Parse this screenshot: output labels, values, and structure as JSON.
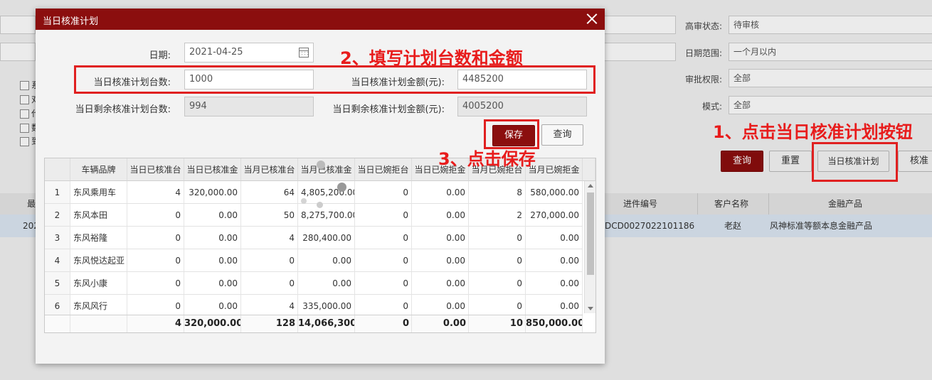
{
  "background": {
    "filters": [
      {
        "label": "高审状态:",
        "value": "待审核"
      },
      {
        "label": "日期范围:",
        "value": "一个月以内"
      },
      {
        "label": "审批权限:",
        "value": "全部"
      },
      {
        "label": "模式:",
        "value": "全部"
      }
    ],
    "checkbox_glyphs": [
      "系",
      "对",
      "代",
      "数",
      "到"
    ],
    "buttons": {
      "query": "查询",
      "reset": "重置",
      "daily_plan": "当日核准计划",
      "approve": "核准"
    },
    "table": {
      "headers": [
        "最",
        "进件编号",
        "客户名称",
        "金融产品"
      ],
      "row": [
        "202",
        "DCD0027022101186",
        "老赵",
        "风神标准等额本息金融产品"
      ]
    }
  },
  "dialog": {
    "title": "当日核准计划",
    "date_label": "日期:",
    "date_value": "2021-04-25",
    "plan_count_label": "当日核准计划台数:",
    "plan_count_value": "1000",
    "plan_amount_label": "当日核准计划金额(元):",
    "plan_amount_value": "4485200",
    "remain_count_label": "当日剩余核准计划台数:",
    "remain_count_value": "994",
    "remain_amount_label": "当日剩余核准计划金额(元):",
    "remain_amount_value": "4005200",
    "save_label": "保存",
    "query_label": "查询",
    "grid": {
      "headers": [
        "",
        "车辆品牌",
        "当日已核准台",
        "当日已核准金",
        "当月已核准台",
        "当月已核准金",
        "当日已婉拒台",
        "当日已婉拒金",
        "当月已婉拒台",
        "当月已婉拒金"
      ],
      "rows": [
        [
          "1",
          "东风乘用车",
          "4",
          "320,000.00",
          "64",
          "4,805,200.00",
          "0",
          "0.00",
          "8",
          "580,000.00"
        ],
        [
          "2",
          "东风本田",
          "0",
          "0.00",
          "50",
          "8,275,700.00",
          "0",
          "0.00",
          "2",
          "270,000.00"
        ],
        [
          "3",
          "东风裕隆",
          "0",
          "0.00",
          "4",
          "280,400.00",
          "0",
          "0.00",
          "0",
          "0.00"
        ],
        [
          "4",
          "东风悦达起亚",
          "0",
          "0.00",
          "0",
          "0.00",
          "0",
          "0.00",
          "0",
          "0.00"
        ],
        [
          "5",
          "东风小康",
          "0",
          "0.00",
          "0",
          "0.00",
          "0",
          "0.00",
          "0",
          "0.00"
        ],
        [
          "6",
          "东风风行",
          "0",
          "0.00",
          "4",
          "335,000.00",
          "0",
          "0.00",
          "0",
          "0.00"
        ]
      ],
      "footer": [
        "",
        "",
        "4",
        "320,000.00",
        "128",
        "14,066,300.",
        "0",
        "0.00",
        "10",
        "850,000.00"
      ]
    }
  },
  "annotations": {
    "step1": "1、点击当日核准计划按钮",
    "step2": "2、填写计划台数和金额",
    "step3": "3、点击保存"
  },
  "colors": {
    "brand": "#8b0e0e",
    "annotation": "#e81c1c"
  }
}
